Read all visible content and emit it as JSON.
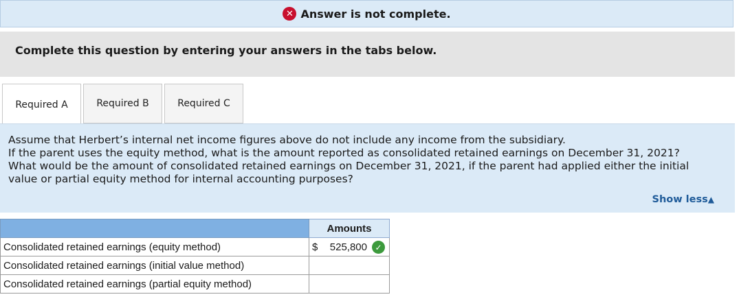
{
  "status": {
    "icon": "error-x-icon",
    "text": "Answer is not complete.",
    "icon_color": "#c8102e"
  },
  "instruction": {
    "text": "Complete this question by entering your answers in the tabs below."
  },
  "tabs": [
    {
      "label": "Required A",
      "active": true
    },
    {
      "label": "Required B",
      "active": false
    },
    {
      "label": "Required C",
      "active": false
    }
  ],
  "question": {
    "lines": [
      "Assume that Herbert’s internal net income figures above do not include any income from the subsidiary.",
      "If the parent uses the equity method, what is the amount reported as consolidated retained earnings on December 31, 2021?",
      "What would be the amount of consolidated retained earnings on December 31, 2021, if the parent had applied either the initial",
      "value or partial equity method for internal accounting purposes?"
    ],
    "show_less": "Show less",
    "show_less_icon": "triangle-up-icon"
  },
  "table": {
    "header_amounts": "Amounts",
    "rows": [
      {
        "label": "Consolidated retained earnings (equity method)",
        "currency": "$",
        "value": "525,800",
        "status_icon": "check-icon"
      },
      {
        "label": "Consolidated retained earnings (initial value method)",
        "currency": "",
        "value": ""
      },
      {
        "label": "Consolidated retained earnings (partial equity method)",
        "currency": "",
        "value": ""
      }
    ]
  },
  "colors": {
    "status_bg": "#dbeaf7",
    "table_header": "#7fb0e2",
    "check": "#3c9a3c"
  }
}
